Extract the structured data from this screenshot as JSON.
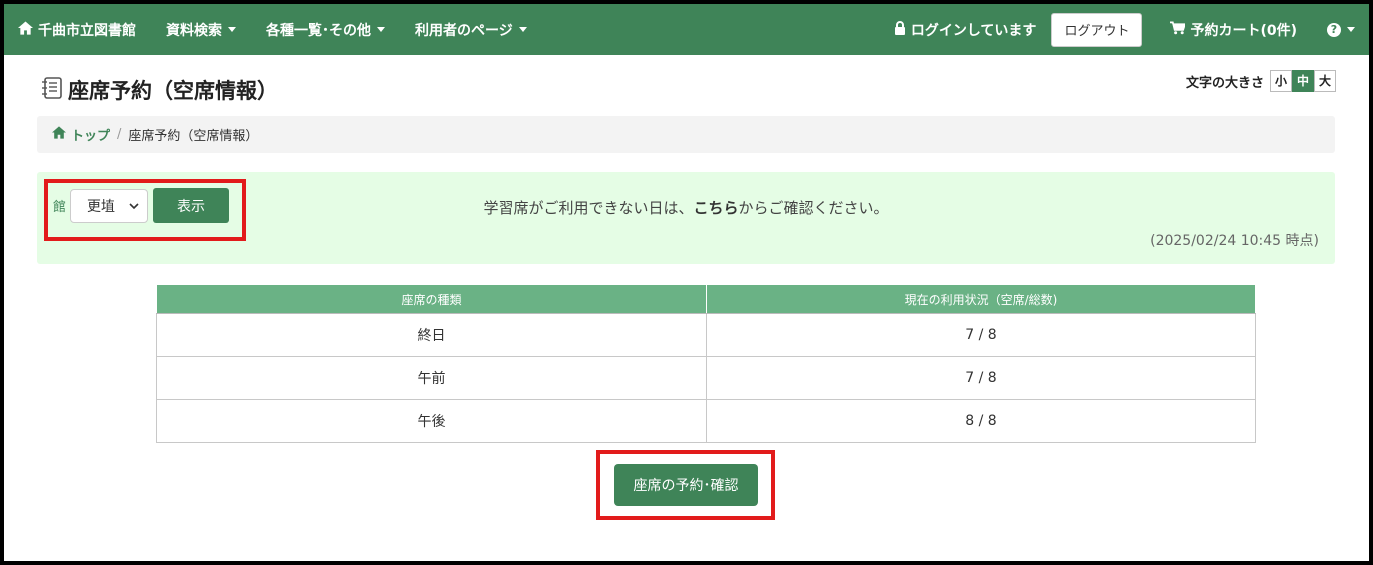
{
  "nav": {
    "brand": "千曲市立図書館",
    "menu": [
      "資料検索",
      "各種一覧･その他",
      "利用者のページ"
    ],
    "login_status": "ログインしています",
    "logout": "ログアウト",
    "cart": "予約カート(0件)",
    "help": "?"
  },
  "page": {
    "title": "座席予約（空席情報）"
  },
  "font_size": {
    "label": "文字の大きさ",
    "small": "小",
    "medium": "中",
    "large": "大"
  },
  "breadcrumb": {
    "home": "トップ",
    "separator": "/",
    "current": "座席予約（空席情報）"
  },
  "panel": {
    "library_label": "館",
    "library_value": "更埴",
    "show_button": "表示",
    "notice_before": "学習席がご利用できない日は、",
    "notice_link": "こちら",
    "notice_after": "からご確認ください。",
    "timestamp": "(2025/02/24 10:45 時点)"
  },
  "table": {
    "headers": [
      "座席の種類",
      "現在の利用状況（空席/総数)"
    ],
    "rows": [
      {
        "type": "終日",
        "status": "7 / 8"
      },
      {
        "type": "午前",
        "status": "7 / 8"
      },
      {
        "type": "午後",
        "status": "8 / 8"
      }
    ]
  },
  "reserve_button": "座席の予約･確認",
  "colors": {
    "primary": "#3f8458",
    "table_header": "#6ab285",
    "panel_bg": "#e5fde5",
    "highlight": "#e21b1b"
  }
}
